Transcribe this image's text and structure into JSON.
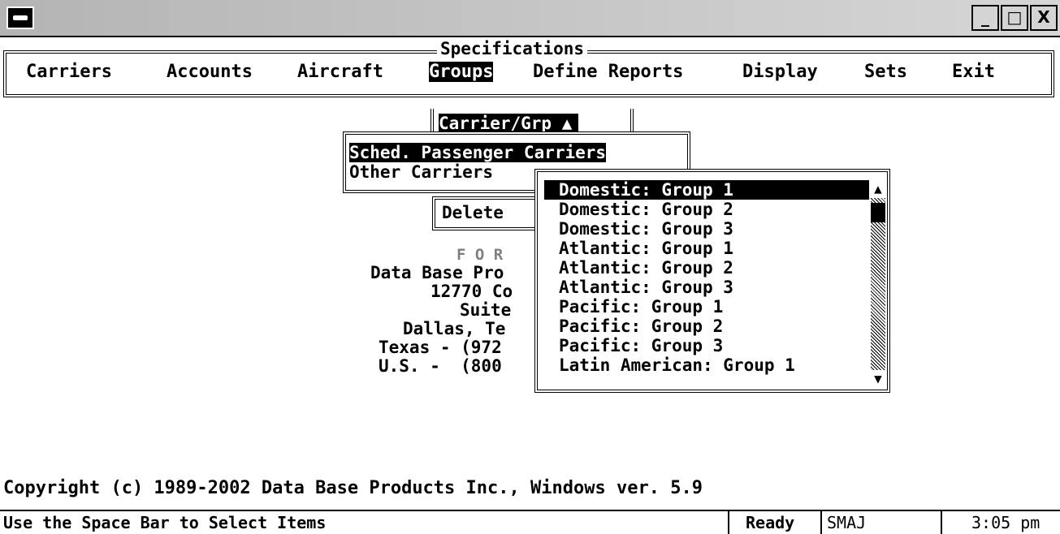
{
  "menu": {
    "title": "Specifications",
    "items": [
      "Carriers",
      "Accounts",
      "Aircraft",
      "Groups",
      "Define Reports",
      "Display",
      "Sets",
      "Exit"
    ],
    "active": "Groups"
  },
  "carrier_grp": {
    "label": "Carrier/Grp"
  },
  "carrier_types": {
    "selected": "Sched. Passenger Carriers",
    "other": "Other Carriers"
  },
  "delete_label": "Delete",
  "background_lines": [
    "F O R",
    "Data Base Pro",
    "12770 Co",
    "Suite",
    "Dallas, Te",
    "Texas - (972",
    "U.S. -  (800"
  ],
  "group_list": [
    "Domestic: Group 1",
    "Domestic: Group 2",
    "Domestic: Group 3",
    "Atlantic: Group 1",
    "Atlantic: Group 2",
    "Atlantic: Group 3",
    "Pacific: Group 1",
    "Pacific: Group 2",
    "Pacific: Group 3",
    "Latin American: Group 1"
  ],
  "copyright": "Copyright (c) 1989-2002 Data Base Products Inc., Windows ver. 5.9",
  "status": {
    "hint": "Use the Space Bar to Select Items",
    "state": "Ready",
    "user": "SMAJ",
    "time": "3:05 pm"
  },
  "window_buttons": {
    "minimize": "_",
    "maximize": "□",
    "close": "X"
  }
}
